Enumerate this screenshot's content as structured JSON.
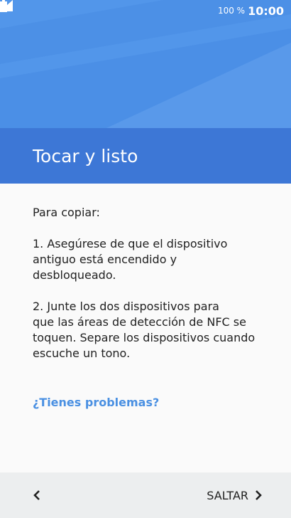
{
  "status_bar": {
    "battery_percent": "100 %",
    "time": "10:00",
    "icons": [
      "signal-icon",
      "battery-icon"
    ]
  },
  "header": {
    "title": "Tocar y listo"
  },
  "body": {
    "intro": "Para copiar:",
    "step1": "1. Asegúrese de que el dispositivo\nantiguo está encendido y\ndesbloqueado.",
    "step2": "2. Junte los dos dispositivos para\nque las áreas de detección de NFC se\ntoquen. Separe los dispositivos cuando\nescuche un tono."
  },
  "help_link": "¿Tienes problemas?",
  "footer": {
    "back_icon": "chevron-left-icon",
    "skip_label": "SALTAR",
    "skip_icon": "chevron-right-icon"
  },
  "colors": {
    "hero": "#4b8fe6",
    "header_band": "#3d77d6",
    "link": "#4a90e2",
    "footer": "#eceeef"
  }
}
